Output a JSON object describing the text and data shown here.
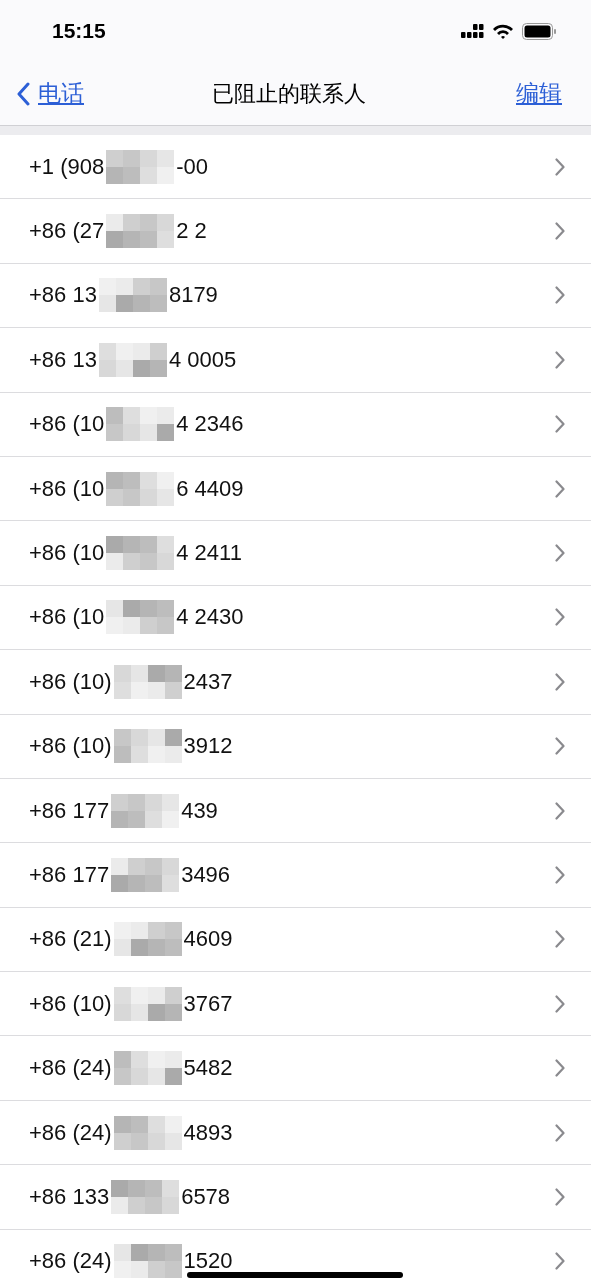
{
  "status_bar": {
    "time": "15:15"
  },
  "nav": {
    "back": "电话",
    "title": "已阻止的联系人",
    "action": "编辑"
  },
  "contacts": [
    {
      "prefix": "+1 (908",
      "suffix": "-00"
    },
    {
      "prefix": "+86 (27",
      "suffix": "2 2"
    },
    {
      "prefix": "+86 13",
      "suffix": "8179"
    },
    {
      "prefix": "+86 13",
      "suffix": "4 0005"
    },
    {
      "prefix": "+86 (10",
      "suffix": "4 2346"
    },
    {
      "prefix": "+86 (10",
      "suffix": "6 4409"
    },
    {
      "prefix": "+86 (10",
      "suffix": "4 2411"
    },
    {
      "prefix": "+86 (10",
      "suffix": "4 2430"
    },
    {
      "prefix": "+86 (10)",
      "suffix": "2437"
    },
    {
      "prefix": "+86 (10)",
      "suffix": "3912"
    },
    {
      "prefix": "+86 177",
      "suffix": "439"
    },
    {
      "prefix": "+86 177",
      "suffix": "3496"
    },
    {
      "prefix": "+86 (21)",
      "suffix": "4609"
    },
    {
      "prefix": "+86 (10)",
      "suffix": "3767"
    },
    {
      "prefix": "+86 (24)",
      "suffix": "5482"
    },
    {
      "prefix": "+86 (24)",
      "suffix": "4893"
    },
    {
      "prefix": "+86 133",
      "suffix": "6578"
    },
    {
      "prefix": "+86 (24)",
      "suffix": "1520"
    }
  ]
}
